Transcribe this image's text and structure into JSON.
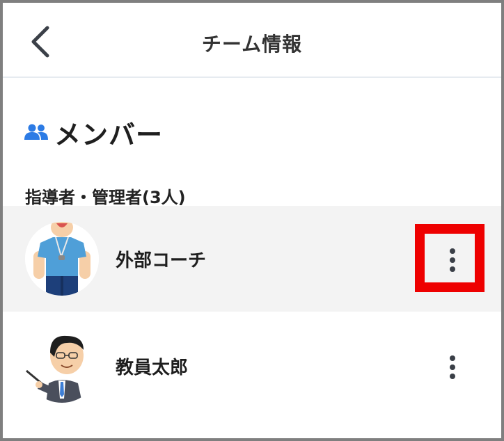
{
  "header": {
    "title": "チーム情報",
    "back_icon": "chevron-left-icon"
  },
  "section": {
    "title": "メンバー",
    "icon": "members-icon",
    "accent_color": "#2c7be5"
  },
  "groups": [
    {
      "label": "指導者・管理者(3人)",
      "members": [
        {
          "name": "外部コーチ",
          "avatar": "coach-avatar-icon",
          "menu_icon": "more-vertical-icon",
          "highlighted": true
        },
        {
          "name": "教員太郎",
          "avatar": "teacher-avatar-icon",
          "menu_icon": "more-vertical-icon",
          "highlighted": false
        }
      ]
    }
  ],
  "annotation": {
    "color": "#ee0000"
  }
}
